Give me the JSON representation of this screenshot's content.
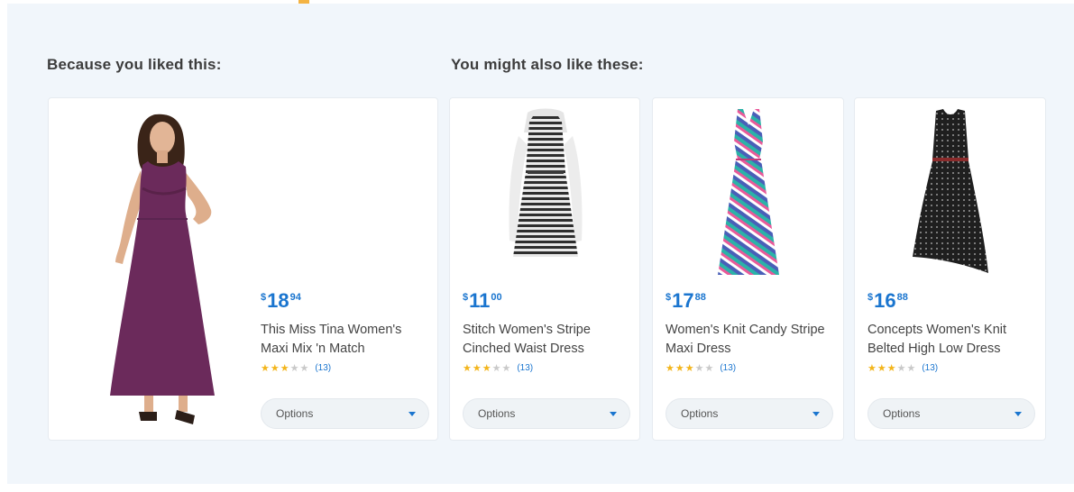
{
  "sections": {
    "left_heading": "Because you liked this:",
    "right_heading": "You might also like these:"
  },
  "colors": {
    "accent_blue": "#1a75cf",
    "star_gold": "#f3b51c",
    "panel_bg": "#f1f6fb"
  },
  "featured": {
    "price": {
      "currency": "$",
      "dollars": "18",
      "cents": "94"
    },
    "title": "This Miss Tina Women's Maxi Mix 'n Match",
    "rating": {
      "filled": 3,
      "total": 5,
      "count": "(13)"
    },
    "options_label": "Options",
    "image": "purple-maxi-dress-model"
  },
  "recommendations": [
    {
      "price": {
        "currency": "$",
        "dollars": "11",
        "cents": "00"
      },
      "title": "Stitch Women's Stripe Cinched Waist Dress",
      "rating": {
        "filled": 3,
        "total": 5,
        "count": "(13)"
      },
      "options_label": "Options",
      "image": "striped-dress-on-mannequin"
    },
    {
      "price": {
        "currency": "$",
        "dollars": "17",
        "cents": "88"
      },
      "title": "Women's Knit Candy Stripe Maxi Dress",
      "rating": {
        "filled": 3,
        "total": 5,
        "count": "(13)"
      },
      "options_label": "Options",
      "image": "candy-stripe-maxi-dress"
    },
    {
      "price": {
        "currency": "$",
        "dollars": "16",
        "cents": "88"
      },
      "title": "Concepts Women's Knit Belted High Low Dress",
      "rating": {
        "filled": 3,
        "total": 5,
        "count": "(13)"
      },
      "options_label": "Options",
      "image": "black-polka-dot-high-low-dress"
    }
  ]
}
